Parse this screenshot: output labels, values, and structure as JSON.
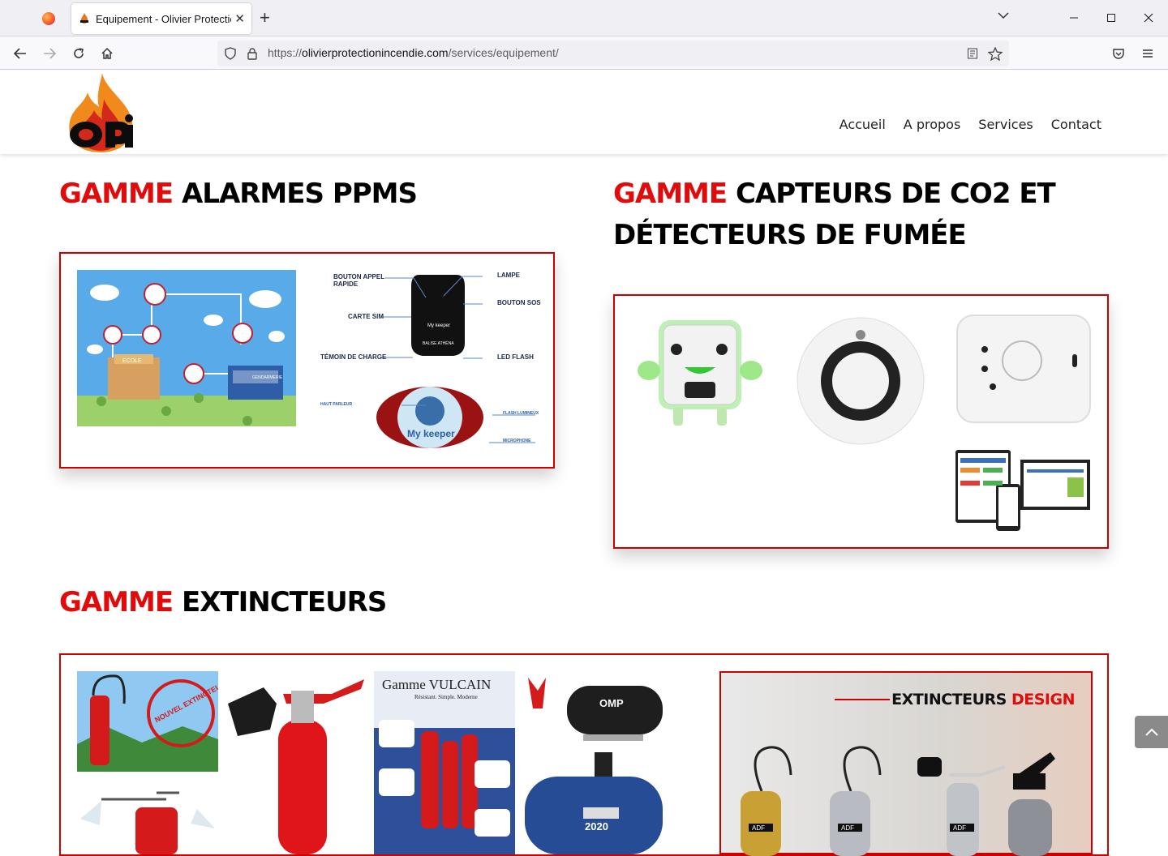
{
  "browser": {
    "tab_title": "Equipement - Olivier Protection",
    "url_prefix": "https://",
    "url_domain": "olivierprotectionincendie.com",
    "url_path": "/services/equipement/"
  },
  "site": {
    "menu": [
      {
        "label": "Accueil"
      },
      {
        "label": "A propos"
      },
      {
        "label": "Services"
      },
      {
        "label": "Contact"
      }
    ]
  },
  "sections": {
    "ppms": {
      "accent": "GAMME",
      "rest": " ALARMES PPMS"
    },
    "co2": {
      "accent": "GAMME",
      "rest_line1": " CAPTEURS DE CO2 ET",
      "rest_line2": "DÉTECTEURS DE FUMÉE"
    },
    "extinct": {
      "accent": "GAMME",
      "rest": " EXTINCTEURS"
    }
  },
  "ppms_image": {
    "school_label": "ECOLE",
    "gendarmerie_label": "GENDARMERIE",
    "callouts": {
      "bouton_appel": "BOUTON APPEL RAPIDE",
      "carte_sim": "CARTE SIM",
      "temoin": "TÉMOIN DE CHARGE",
      "lampe": "LAMPE",
      "bouton_sos": "BOUTON SOS",
      "led_flash": "LED FLASH",
      "haut_parleur": "HAUT PARLEUR",
      "flash_lumineux": "FLASH LUMINEUX",
      "microphone": "MICROPHONE",
      "device_brand": "My keeper",
      "device_sub": "BALISE ATHÉNA"
    }
  },
  "extinct_image": {
    "vulcain_title": "Gamme VULCAIN",
    "vulcain_sub": "Résistant. Simple. Moderne",
    "badge": "NOUVEL EXTINCTEUR SANS FLUOR",
    "omp": "OMP",
    "year": "2020",
    "design_prefix": "EXTINCTEURS ",
    "design_accent": "DESIGN",
    "adf": "ADF"
  },
  "colors": {
    "accent_red": "#e00b0b",
    "frame_red": "#cc0000"
  }
}
